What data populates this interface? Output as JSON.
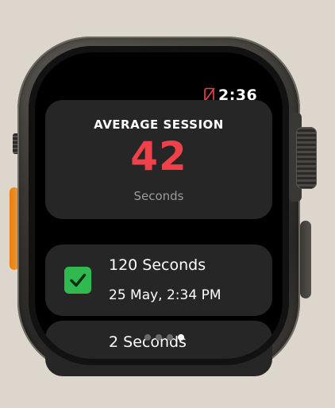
{
  "status_bar": {
    "time": "2:36",
    "icon": "phone-disconnected-icon",
    "icon_color": "#f0414a"
  },
  "summary": {
    "title": "AVERAGE SESSION",
    "value": "42",
    "unit": "Seconds",
    "value_color": "#f0414a"
  },
  "sessions": [
    {
      "duration": "120 Seconds",
      "date": "25 May, 2:34 PM",
      "status_icon": "checkmark-icon",
      "status_color": "#30b94f"
    },
    {
      "duration": "2 Seconds"
    }
  ],
  "page_indicator": {
    "count": 4,
    "active_index": 3
  },
  "hardware": {
    "action_button_color": "#f29a2e"
  }
}
